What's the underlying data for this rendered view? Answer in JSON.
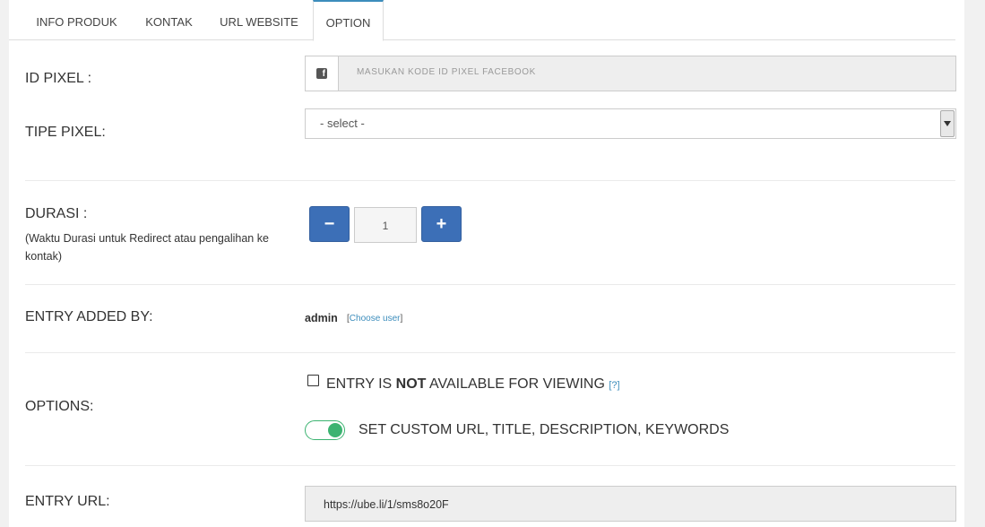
{
  "tabs": [
    {
      "label": "INFO PRODUK"
    },
    {
      "label": "KONTAK"
    },
    {
      "label": "URL WEBSITE"
    },
    {
      "label": "OPTION"
    }
  ],
  "id_pixel": {
    "label": "ID PIXEL :",
    "placeholder": "MASUKAN KODE ID PIXEL FACEBOOK",
    "icon": "facebook-icon"
  },
  "tipe_pixel": {
    "label": "TIPE PIXEL:",
    "selected": "- select -"
  },
  "durasi": {
    "label": "DURASI :",
    "hint": "(Waktu Durasi untuk Redirect atau pengalihan ke kontak)",
    "value": "1",
    "minus": "−",
    "plus": "+"
  },
  "entry_added_by": {
    "label": "ENTRY ADDED BY:",
    "user": "admin",
    "choose_prefix": "[",
    "choose_link": "Choose user",
    "choose_suffix": "]"
  },
  "options": {
    "label": "OPTIONS:",
    "not_available": {
      "prefix": "ENTRY IS ",
      "bold": "NOT",
      "suffix": " AVAILABLE FOR VIEWING",
      "help": "[?]"
    },
    "custom_url": {
      "text": "SET CUSTOM URL, TITLE, DESCRIPTION, KEYWORDS",
      "enabled": true
    }
  },
  "entry_url": {
    "label": "ENTRY URL:",
    "value": "https://ube.li/1/sms8o20F"
  },
  "colors": {
    "primary": "#3c6fb7",
    "toggle": "#3cb371",
    "link": "#3c8dbc"
  }
}
